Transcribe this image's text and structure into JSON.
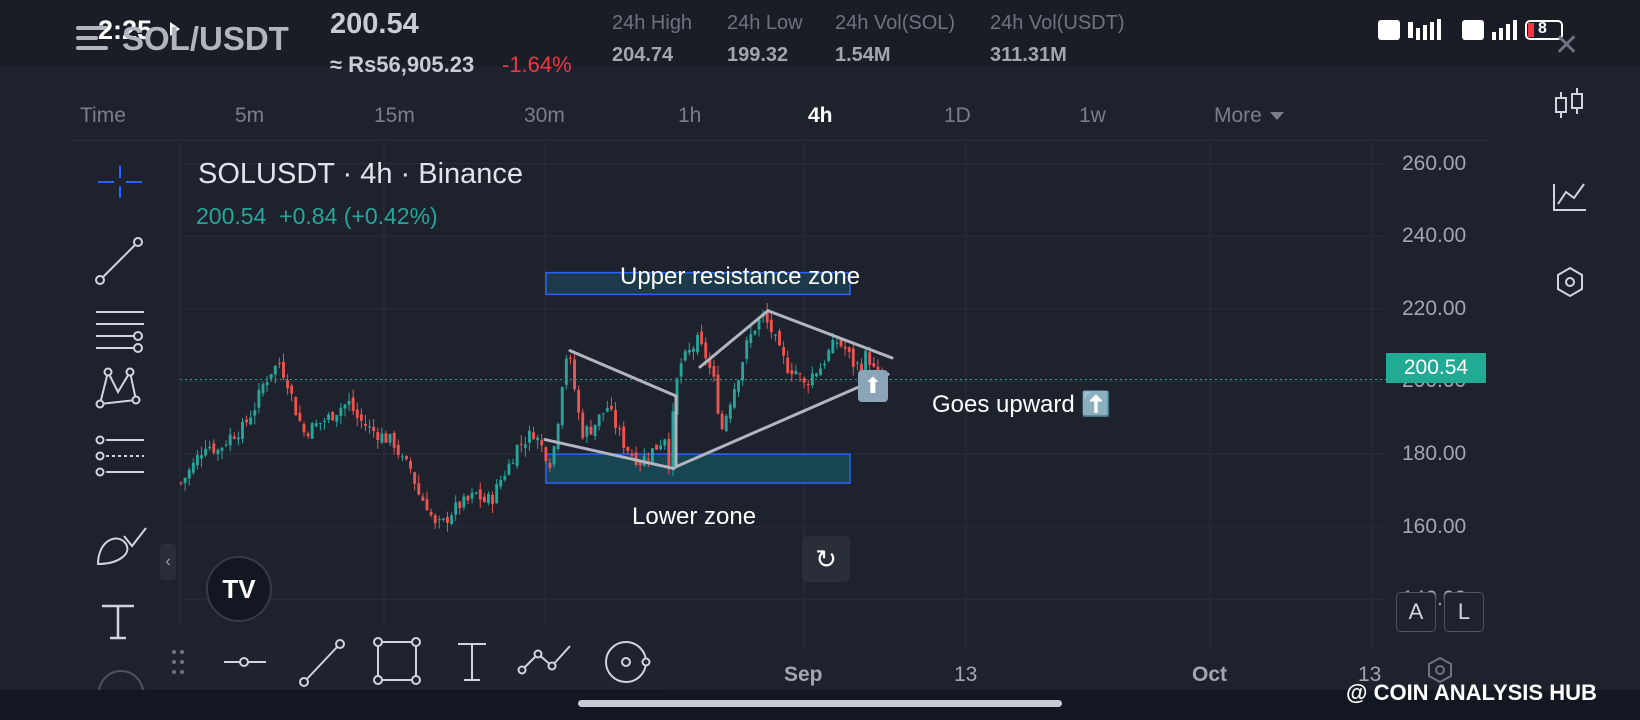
{
  "status_bar": {
    "time": "2:25",
    "battery": "8"
  },
  "header": {
    "pair": "SOL/USDT",
    "price": "200.54",
    "price_local": "≈ Rs56,905.23",
    "change": "-1.64%",
    "stats": [
      {
        "label": "24h High",
        "value": "204.74"
      },
      {
        "label": "24h Low",
        "value": "199.32"
      },
      {
        "label": "24h Vol(SOL)",
        "value": "1.54M"
      },
      {
        "label": "24h Vol(USDT)",
        "value": "311.31M"
      }
    ]
  },
  "timeframes": [
    "Time",
    "5m",
    "15m",
    "30m",
    "1h",
    "4h",
    "1D",
    "1w",
    "More"
  ],
  "active_timeframe": "4h",
  "chart_header": {
    "title": "SOLUSDT · 4h · Binance",
    "last": "200.54",
    "change": "+0.84",
    "change_pct": "(+0.42%)"
  },
  "chart_data": {
    "type": "candlestick",
    "y_ticks": [
      "260.00",
      "240.00",
      "220.00",
      "200.00",
      "180.00",
      "160.00",
      "140.00"
    ],
    "ylim": [
      126,
      266
    ],
    "x_ticks": [
      "Sep",
      "13",
      "Oct",
      "13"
    ],
    "last_price": "200.54",
    "series": [
      {
        "close_path": [
          [
            0,
            172
          ],
          [
            3,
            177
          ],
          [
            6,
            183
          ],
          [
            9,
            181
          ],
          [
            12,
            185
          ],
          [
            15,
            187
          ],
          [
            18,
            193
          ],
          [
            20,
            199
          ],
          [
            22,
            203
          ],
          [
            24,
            205
          ],
          [
            26,
            200
          ],
          [
            28,
            192
          ],
          [
            30,
            186
          ],
          [
            33,
            188
          ],
          [
            36,
            190
          ],
          [
            39,
            193
          ],
          [
            41,
            194
          ],
          [
            43,
            190
          ],
          [
            46,
            187
          ],
          [
            49,
            185
          ],
          [
            52,
            183
          ],
          [
            54,
            178
          ],
          [
            56,
            176
          ],
          [
            58,
            169
          ],
          [
            60,
            166
          ],
          [
            62,
            160
          ],
          [
            64,
            161
          ],
          [
            66,
            164
          ],
          [
            68,
            166
          ],
          [
            70,
            167
          ],
          [
            72,
            169
          ],
          [
            74,
            167
          ],
          [
            76,
            168
          ],
          [
            78,
            173
          ],
          [
            80,
            177
          ],
          [
            82,
            182
          ],
          [
            84,
            184
          ],
          [
            86,
            186
          ],
          [
            88,
            182
          ],
          [
            90,
            178
          ],
          [
            91,
            182
          ],
          [
            92,
            190
          ],
          [
            93,
            200
          ],
          [
            94,
            207
          ],
          [
            95,
            205
          ],
          [
            96,
            198
          ],
          [
            97,
            191
          ],
          [
            98,
            186
          ],
          [
            100,
            187
          ],
          [
            102,
            190
          ],
          [
            104,
            193
          ],
          [
            106,
            188
          ],
          [
            108,
            183
          ],
          [
            110,
            180
          ],
          [
            112,
            178
          ],
          [
            114,
            180
          ],
          [
            116,
            182
          ],
          [
            118,
            185
          ],
          [
            119,
            178
          ],
          [
            120,
            190
          ],
          [
            121,
            200
          ],
          [
            122,
            205
          ],
          [
            124,
            208
          ],
          [
            126,
            211
          ],
          [
            128,
            207
          ],
          [
            130,
            200
          ],
          [
            131,
            193
          ],
          [
            132,
            187
          ],
          [
            134,
            195
          ],
          [
            136,
            202
          ],
          [
            138,
            210
          ],
          [
            140,
            215
          ],
          [
            142,
            218
          ],
          [
            144,
            214
          ],
          [
            146,
            208
          ],
          [
            148,
            204
          ],
          [
            150,
            203
          ],
          [
            152,
            199
          ],
          [
            154,
            202
          ],
          [
            156,
            204
          ],
          [
            158,
            208
          ],
          [
            160,
            211
          ],
          [
            162,
            209
          ],
          [
            164,
            205
          ],
          [
            166,
            204
          ],
          [
            167,
            207
          ],
          [
            168,
            206
          ],
          [
            169,
            203
          ],
          [
            170,
            201
          ],
          [
            171,
            200.5
          ]
        ]
      }
    ],
    "annotations": {
      "upper_zone": {
        "low": 224,
        "high": 230,
        "label": "Upper resistance zone"
      },
      "lower_zone": {
        "low": 172,
        "high": 180,
        "label": "Lower zone"
      },
      "right_label": "Goes upward ⬆️"
    }
  },
  "right_panel": {
    "buttons": [
      "A",
      "L"
    ]
  },
  "watermark": "@ COIN ANALYSIS HUB",
  "icons": {
    "left_toolbar": [
      "crosshair-icon",
      "trendline-icon",
      "fib-icon",
      "pattern-icon",
      "projection-icon",
      "brush-icon",
      "text-icon"
    ],
    "bottom_toolbar": [
      "drag-handle-icon",
      "horizontal-line-icon",
      "line-icon",
      "rectangle-icon",
      "text-icon",
      "path-icon",
      "circle-icon"
    ],
    "right_toolbar": [
      "candle-type-icon",
      "indicators-icon",
      "settings-hex-icon"
    ]
  },
  "colors": {
    "up": "#26a69a",
    "down": "#ef5350",
    "accent_blue": "#2962ff",
    "last_price": "#22ab94"
  }
}
